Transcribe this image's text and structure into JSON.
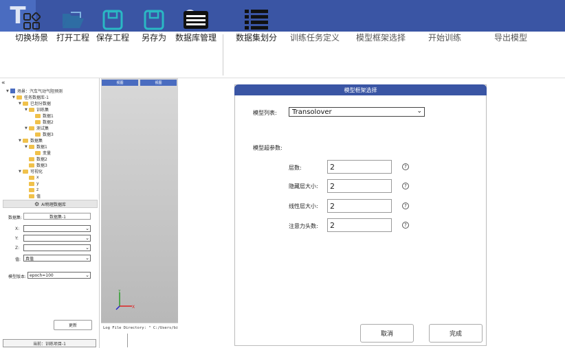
{
  "header": {
    "logo_letter": "T",
    "help_icon": "?"
  },
  "toolbar": {
    "items": [
      {
        "label": "切换场景",
        "icon": "switch-scene-icon"
      },
      {
        "label": "打开工程",
        "icon": "folder-open-icon"
      },
      {
        "label": "保存工程",
        "icon": "save-icon"
      },
      {
        "label": "另存为",
        "icon": "save-as-icon"
      },
      {
        "label": "数据库管理",
        "icon": "database-icon"
      },
      {
        "label": "数据集划分",
        "icon": "list-icon"
      },
      {
        "label": "训练任务定义"
      },
      {
        "label": "模型框架选择"
      },
      {
        "label": "开始训练"
      },
      {
        "label": "导出模型"
      }
    ]
  },
  "left": {
    "collapse": "«",
    "tree": [
      {
        "text": "场景：汽车气动气阻预测",
        "level": 0,
        "type": "root"
      },
      {
        "text": "任务数据库-1",
        "level": 1,
        "type": "folder"
      },
      {
        "text": "已划分数据",
        "level": 2,
        "type": "folder"
      },
      {
        "text": "训练集",
        "level": 3,
        "type": "folder"
      },
      {
        "text": "数据1",
        "level": 4,
        "type": "folder"
      },
      {
        "text": "数据2",
        "level": 4,
        "type": "folder"
      },
      {
        "text": "测试集",
        "level": 3,
        "type": "folder"
      },
      {
        "text": "数据3",
        "level": 4,
        "type": "folder"
      },
      {
        "text": "数据集",
        "level": 2,
        "type": "folder"
      },
      {
        "text": "数据1",
        "level": 3,
        "type": "folder"
      },
      {
        "text": "变量",
        "level": 4,
        "type": "folder"
      },
      {
        "text": "数据2",
        "level": 3,
        "type": "folder"
      },
      {
        "text": "数据3",
        "level": 3,
        "type": "folder"
      },
      {
        "text": "可视化",
        "level": 2,
        "type": "folder"
      },
      {
        "text": "x",
        "level": 3,
        "type": "folder"
      },
      {
        "text": "y",
        "level": 3,
        "type": "folder"
      },
      {
        "text": "z",
        "level": 3,
        "type": "folder"
      },
      {
        "text": "值",
        "level": 3,
        "type": "folder"
      }
    ],
    "tab_label": "AI物理数据库",
    "form": {
      "dataset_label": "数据集:",
      "dataset_value": "数据集-1",
      "x_label": "X:",
      "y_label": "Y:",
      "z_label": "Z:",
      "value_label": "值:",
      "value_select": "真值",
      "model_version_label": "模型版本:",
      "model_version_value": "epoch=100",
      "refresh_button": "更新"
    },
    "status": "当前：训练项目-1"
  },
  "viewport": {
    "tab1": "视图",
    "tab2": "视图",
    "log_text": "Log File Directory: \" C:/Users/bing"
  },
  "dialog": {
    "title": "模型框架选择",
    "model_list_label": "模型列表:",
    "model_list_value": "Transolover",
    "hyperparams_label": "模型超参数:",
    "params": [
      {
        "label": "层数:",
        "value": "2"
      },
      {
        "label": "隐藏层大小:",
        "value": "2"
      },
      {
        "label": "线性层大小:",
        "value": "2"
      },
      {
        "label": "注意力头数:",
        "value": "2"
      }
    ],
    "cancel": "取消",
    "finish": "完成"
  }
}
